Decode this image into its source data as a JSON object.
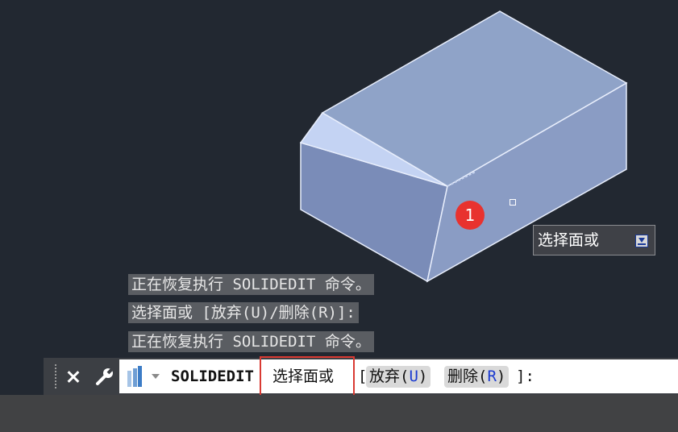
{
  "history": [
    "正在恢复执行 SOLIDEDIT 命令。",
    "选择面或 [放弃(U)/删除(R)]:",
    "正在恢复执行 SOLIDEDIT 命令。"
  ],
  "annotation": {
    "step_number": "1"
  },
  "tooltip": {
    "text": "选择面或",
    "icon": "insert-down-icon"
  },
  "command_line": {
    "command_name": "SOLIDEDIT",
    "prompt": "选择面或",
    "bracket_open": "[",
    "options": [
      {
        "label": "放弃",
        "key": "U"
      },
      {
        "label": "删除",
        "key": "R"
      }
    ],
    "bracket_close": "]:",
    "icons": {
      "close": "close-icon",
      "customize": "wrench-icon",
      "command": "command-line-icon"
    }
  },
  "colors": {
    "background": "#222831",
    "solid_front": "#7a8db8",
    "solid_top": "#8fa2c6",
    "solid_bevel": "#c3d2f2",
    "highlight": "#d93a33",
    "option_key": "#1a3ad0"
  }
}
